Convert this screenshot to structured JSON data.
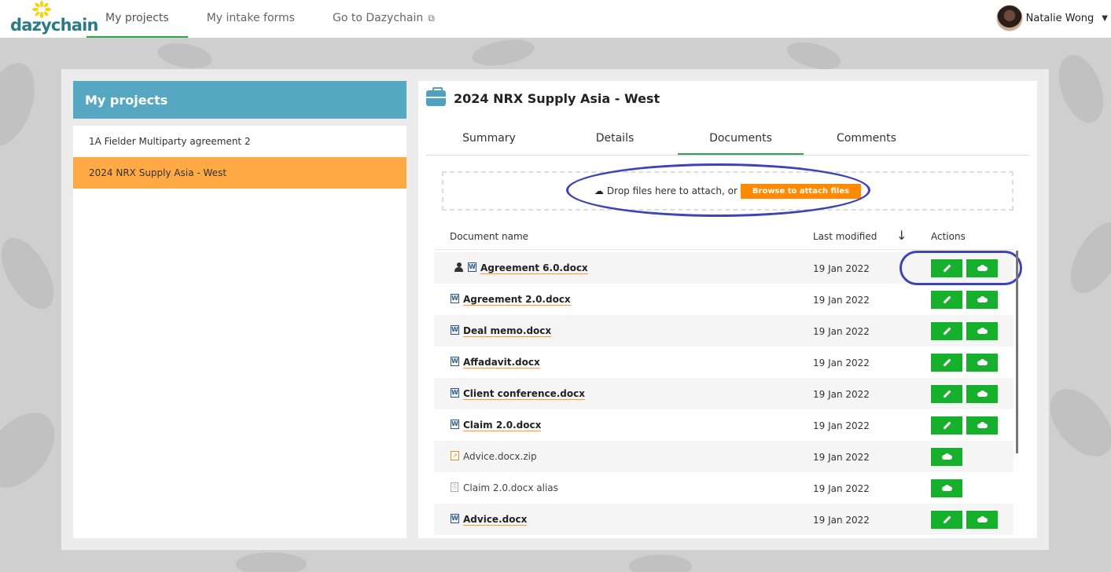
{
  "app": {
    "logo_text": "dazychain",
    "brand_colors": {
      "teal": "#2c7a85",
      "yellow": "#f5d40e",
      "green": "#16b02c",
      "orange": "#ff8a00",
      "header_blue": "#56a8c2",
      "selected": "#ffaa44"
    }
  },
  "nav": {
    "tabs": [
      {
        "label": "My projects",
        "active": true
      },
      {
        "label": "My intake forms",
        "active": false
      },
      {
        "label": "Go to Dazychain",
        "icon": "external-link-icon",
        "active": false
      }
    ]
  },
  "user": {
    "name": "Natalie Wong"
  },
  "left_panel": {
    "title": "My projects",
    "projects": [
      {
        "name": "1A Fielder Multiparty agreement 2",
        "selected": false
      },
      {
        "name": "2024 NRX Supply Asia - West",
        "selected": true
      }
    ]
  },
  "project": {
    "title": "2024 NRX Supply Asia - West",
    "tabs": [
      {
        "label": "Summary",
        "active": false
      },
      {
        "label": "Details",
        "active": false
      },
      {
        "label": "Documents",
        "active": true
      },
      {
        "label": "Comments",
        "active": false
      }
    ],
    "dropzone": {
      "text": "Drop files here to attach, or",
      "button_label": "Browse to attach files"
    },
    "table": {
      "col_name": "Document name",
      "col_modified": "Last modified",
      "col_actions": "Actions",
      "rows": [
        {
          "name": "Agreement 6.0.docx",
          "type": "word",
          "owner_icon": true,
          "modified": "19 Jan 2022",
          "editable": true,
          "bold": true
        },
        {
          "name": "Agreement 2.0.docx",
          "type": "word",
          "owner_icon": false,
          "modified": "19 Jan 2022",
          "editable": true,
          "bold": true
        },
        {
          "name": "Deal memo.docx",
          "type": "word",
          "owner_icon": false,
          "modified": "19 Jan 2022",
          "editable": true,
          "bold": true
        },
        {
          "name": "Affadavit.docx",
          "type": "word",
          "owner_icon": false,
          "modified": "19 Jan 2022",
          "editable": true,
          "bold": true
        },
        {
          "name": "Client conference.docx",
          "type": "word",
          "owner_icon": false,
          "modified": "19 Jan 2022",
          "editable": true,
          "bold": true
        },
        {
          "name": "Claim 2.0.docx",
          "type": "word",
          "owner_icon": false,
          "modified": "19 Jan 2022",
          "editable": true,
          "bold": true
        },
        {
          "name": "Advice.docx.zip",
          "type": "zip",
          "owner_icon": false,
          "modified": "19 Jan 2022",
          "editable": false,
          "bold": false
        },
        {
          "name": "Claim 2.0.docx alias",
          "type": "alias",
          "owner_icon": false,
          "modified": "19 Jan 2022",
          "editable": false,
          "bold": false
        },
        {
          "name": "Advice.docx",
          "type": "word",
          "owner_icon": false,
          "modified": "19 Jan 2022",
          "editable": true,
          "bold": true
        }
      ]
    }
  }
}
